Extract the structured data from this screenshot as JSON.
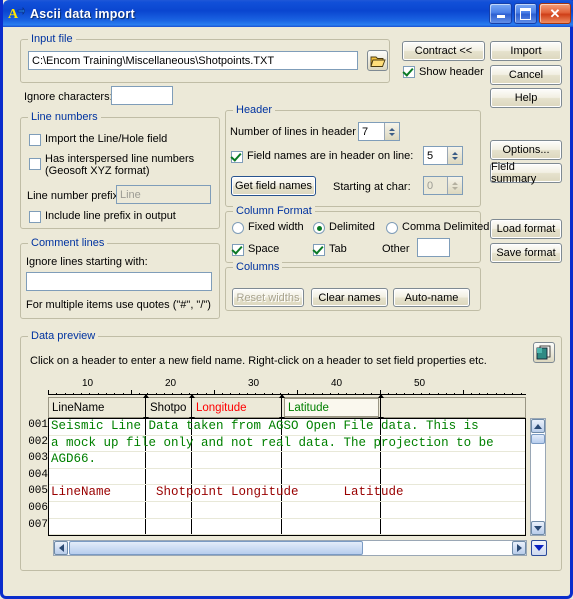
{
  "window": {
    "title": "Ascii data import",
    "icon": "ascii-import-icon",
    "buttons": {
      "minimize": "minimize-icon",
      "maximize": "maximize-icon",
      "close": "close-icon"
    }
  },
  "input_file": {
    "legend": "Input file",
    "path": "C:\\Encom Training\\Miscellaneous\\Shotpoints.TXT",
    "browse_icon": "folder-open-icon"
  },
  "contract": {
    "label": "Contract <<"
  },
  "show_header": {
    "label": "Show header",
    "checked": true
  },
  "ignore_characters": {
    "label": "Ignore characters:",
    "value": ""
  },
  "line_numbers": {
    "legend": "Line numbers",
    "import_line_hole": {
      "label": "Import the Line/Hole field",
      "checked": false
    },
    "interspersed": {
      "label": "Has interspersed line numbers (Geosoft XYZ format)",
      "line1": "Has interspersed line numbers",
      "line2": "(Geosoft XYZ format)",
      "checked": false
    },
    "prefix_label": "Line number prefix:",
    "prefix_value": "Line",
    "include_prefix": {
      "label": "Include line prefix in output",
      "checked": false
    }
  },
  "comment_lines": {
    "legend": "Comment lines",
    "ignore_label": "Ignore lines starting with:",
    "ignore_value": "",
    "hint": "For multiple items use quotes (\"#\", \"/\")"
  },
  "header": {
    "legend": "Header",
    "num_lines_label": "Number of lines in header",
    "num_lines_value": "7",
    "field_names_checkbox": {
      "label": "Field names are in header on line:",
      "checked": true
    },
    "field_names_line": "5",
    "get_field_names_button": "Get field names",
    "starting_char_label": "Starting at char:",
    "starting_char_value": "0"
  },
  "column_format": {
    "legend": "Column Format",
    "options": [
      {
        "label": "Fixed width",
        "selected": false
      },
      {
        "label": "Delimited",
        "selected": true
      },
      {
        "label": "Comma Delimited",
        "selected": false
      }
    ],
    "space": {
      "label": "Space",
      "checked": true
    },
    "tab": {
      "label": "Tab",
      "checked": true
    },
    "other_label": "Other",
    "other_value": ""
  },
  "columns": {
    "legend": "Columns",
    "reset_widths": {
      "label": "Reset widths",
      "enabled": false
    },
    "clear_names": {
      "label": "Clear names",
      "enabled": true
    },
    "auto_name": {
      "label": "Auto-name",
      "enabled": true
    }
  },
  "side_buttons": {
    "import": "Import",
    "cancel": "Cancel",
    "help": "Help",
    "options": "Options...",
    "field_summary": "Field summary",
    "load_format": "Load format",
    "save_format": "Save format"
  },
  "data_preview": {
    "legend": "Data preview",
    "instructions": "Click on a header to enter a new field name.  Right-click on a header to set field properties etc.",
    "copy_icon": "copy-preview-icon",
    "ruler_labels": [
      "10",
      "20",
      "30",
      "40",
      "50"
    ],
    "field_headers": [
      {
        "name": "LineName",
        "color": "#000000"
      },
      {
        "name": "Shotpo",
        "color": "#000000"
      },
      {
        "name": "Longitude",
        "color": "#ff0000"
      },
      {
        "name": "Latitude",
        "color": "#008000"
      },
      {
        "name": "",
        "color": "#000000"
      }
    ],
    "row_numbers": [
      "001",
      "002",
      "003",
      "004",
      "005",
      "006",
      "007"
    ],
    "rows": [
      {
        "text": "Seismic Line Data taken from AGSO Open File data. This is",
        "color": "#008000"
      },
      {
        "text": "a mock up file only and not real data. The projection to be",
        "color": "#008000"
      },
      {
        "text": "AGD66.",
        "color": "#008000"
      },
      {
        "text": "",
        "color": "#008000"
      },
      {
        "text": "LineName      Shotpoint Longitude      Latitude",
        "color": "#990000"
      },
      {
        "text": "",
        "color": "#008000"
      },
      {
        "text": "",
        "color": "#008000"
      }
    ]
  }
}
